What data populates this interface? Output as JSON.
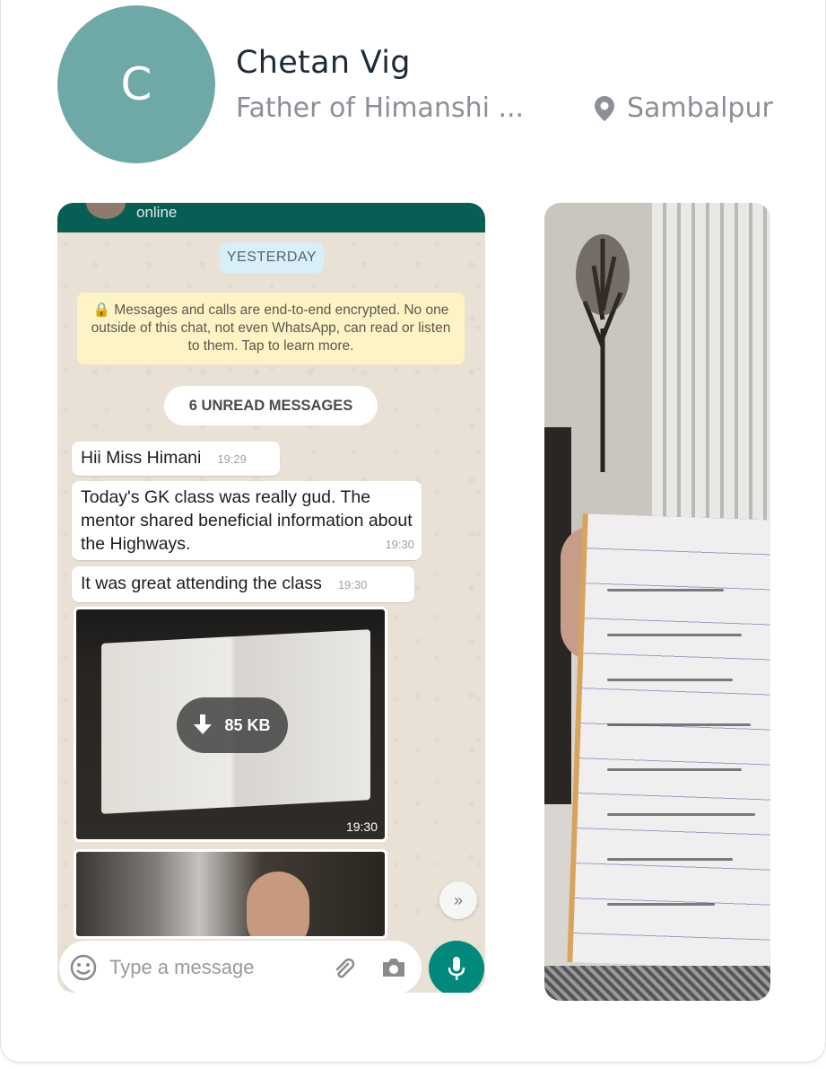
{
  "profile": {
    "avatar_initial": "C",
    "avatar_color": "#6fa9a7",
    "name": "Chetan Vig",
    "relation": "Father of Himanshi ...",
    "location": "Sambalpur",
    "location_icon": "map-pin-icon"
  },
  "screenshot_chat": {
    "status": "online",
    "day_chip": "YESTERDAY",
    "encryption_notice": "🔒 Messages and calls are end-to-end encrypted. No one outside of this chat, not even WhatsApp, can read or listen to them. Tap to learn more.",
    "unread_label": "6 UNREAD MESSAGES",
    "messages": [
      {
        "text": "Hii Miss Himani",
        "time": "19:29"
      },
      {
        "text": "Today's GK class was really gud. The mentor shared beneficial information about the Highways.",
        "time": "19:30"
      },
      {
        "text": "It was great attending the class",
        "time": "19:30"
      }
    ],
    "image_download_size": "85 KB",
    "image_time": "19:30",
    "input_placeholder": "Type a message",
    "accent_color": "#075e54"
  }
}
